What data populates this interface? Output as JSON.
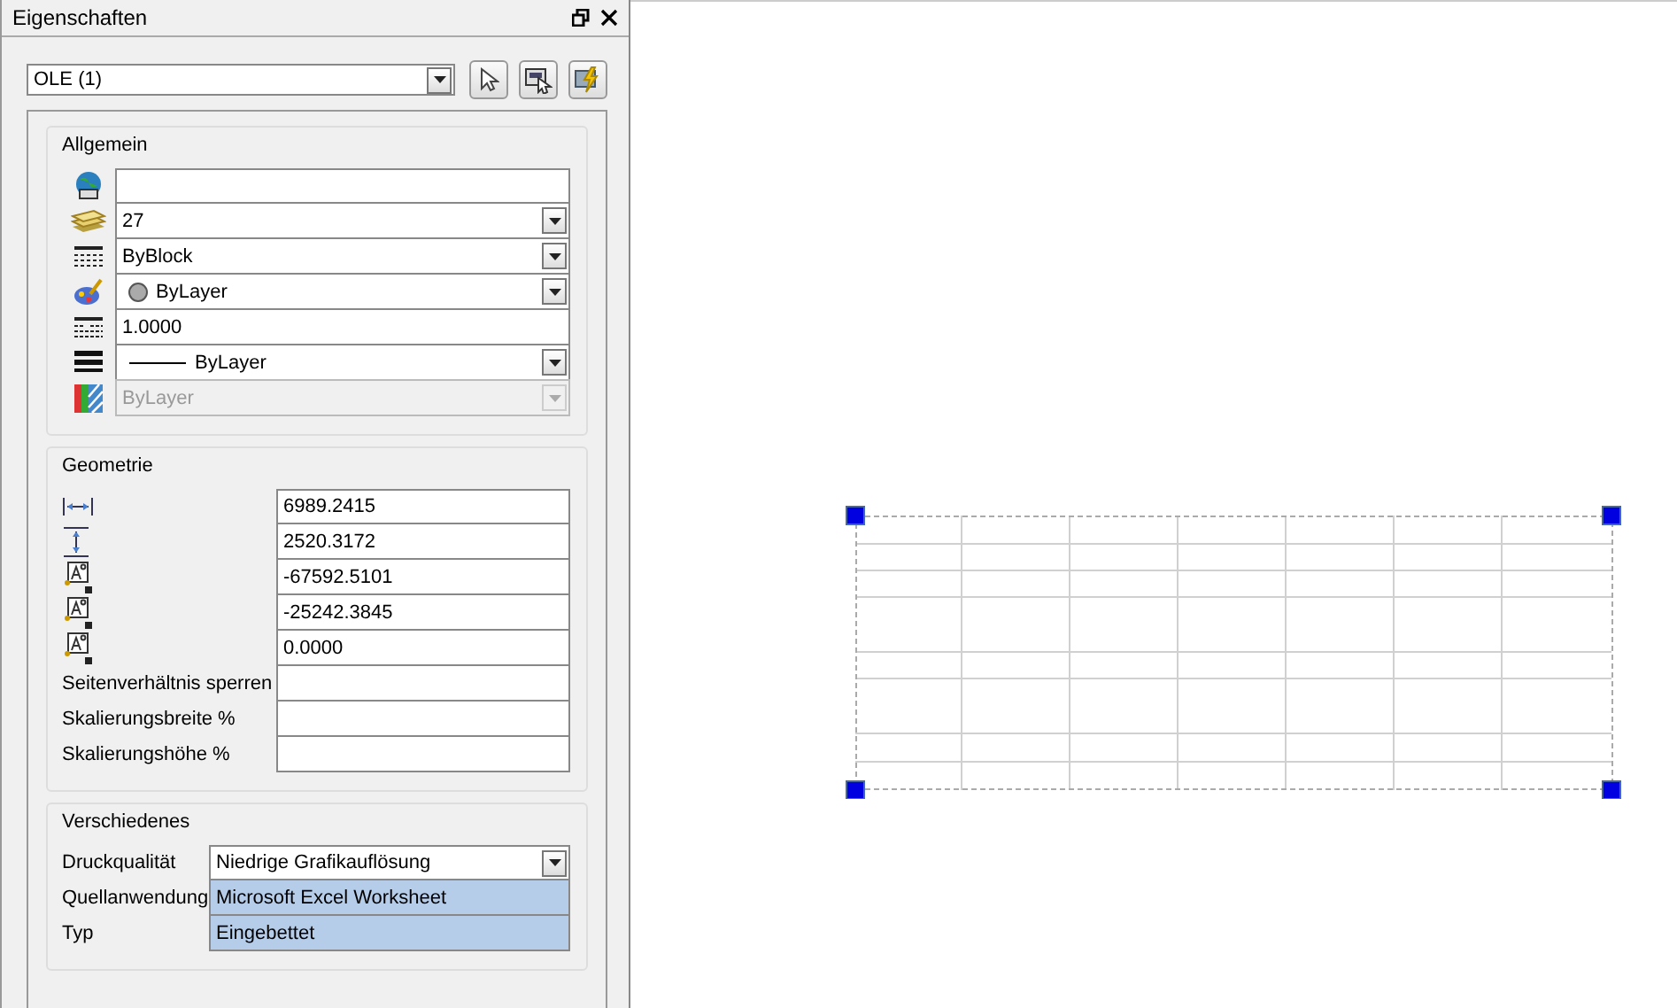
{
  "panel": {
    "title": "Eigenschaften",
    "selector": {
      "value": "OLE (1)"
    }
  },
  "sections": [
    {
      "title": "Allgemein",
      "kind": "icons",
      "rows": [
        {
          "kind": "text",
          "value": "",
          "disabled": false
        },
        {
          "kind": "dropdown",
          "value": "27",
          "disabled": false
        },
        {
          "kind": "dropdown",
          "value": "ByBlock",
          "disabled": false
        },
        {
          "kind": "dropdown",
          "value": "ByLayer",
          "swatch": true,
          "disabled": false
        },
        {
          "kind": "text",
          "value": "1.0000",
          "disabled": false
        },
        {
          "kind": "dropdown",
          "value": "ByLayer",
          "line_sample": true,
          "disabled": false
        },
        {
          "kind": "dropdown",
          "value": "ByLayer",
          "disabled": true
        }
      ]
    },
    {
      "title": "Geometrie",
      "kind": "geometry",
      "rows": [
        {
          "kind": "text",
          "value": "6989.2415"
        },
        {
          "kind": "text",
          "value": "2520.3172"
        },
        {
          "kind": "text",
          "value": "-67592.5101"
        },
        {
          "kind": "text",
          "value": "-25242.3845"
        },
        {
          "kind": "text",
          "value": "0.0000"
        },
        {
          "kind": "text",
          "label": "Seitenverhältnis sperren",
          "value": ""
        },
        {
          "kind": "text",
          "label": "Skalierungsbreite %",
          "value": ""
        },
        {
          "kind": "text",
          "label": "Skalierungshöhe %",
          "value": ""
        }
      ]
    },
    {
      "title": "Verschiedenes",
      "kind": "labels",
      "rows": [
        {
          "kind": "dropdown",
          "label": "Druckqualität",
          "value": "Niedrige Grafikauflösung",
          "highlighted": false
        },
        {
          "kind": "text",
          "label": "Quellanwendung",
          "value": "Microsoft Excel Worksheet",
          "highlighted": true
        },
        {
          "kind": "text",
          "label": "Typ",
          "value": "Eingebettet",
          "highlighted": true
        }
      ]
    }
  ]
}
